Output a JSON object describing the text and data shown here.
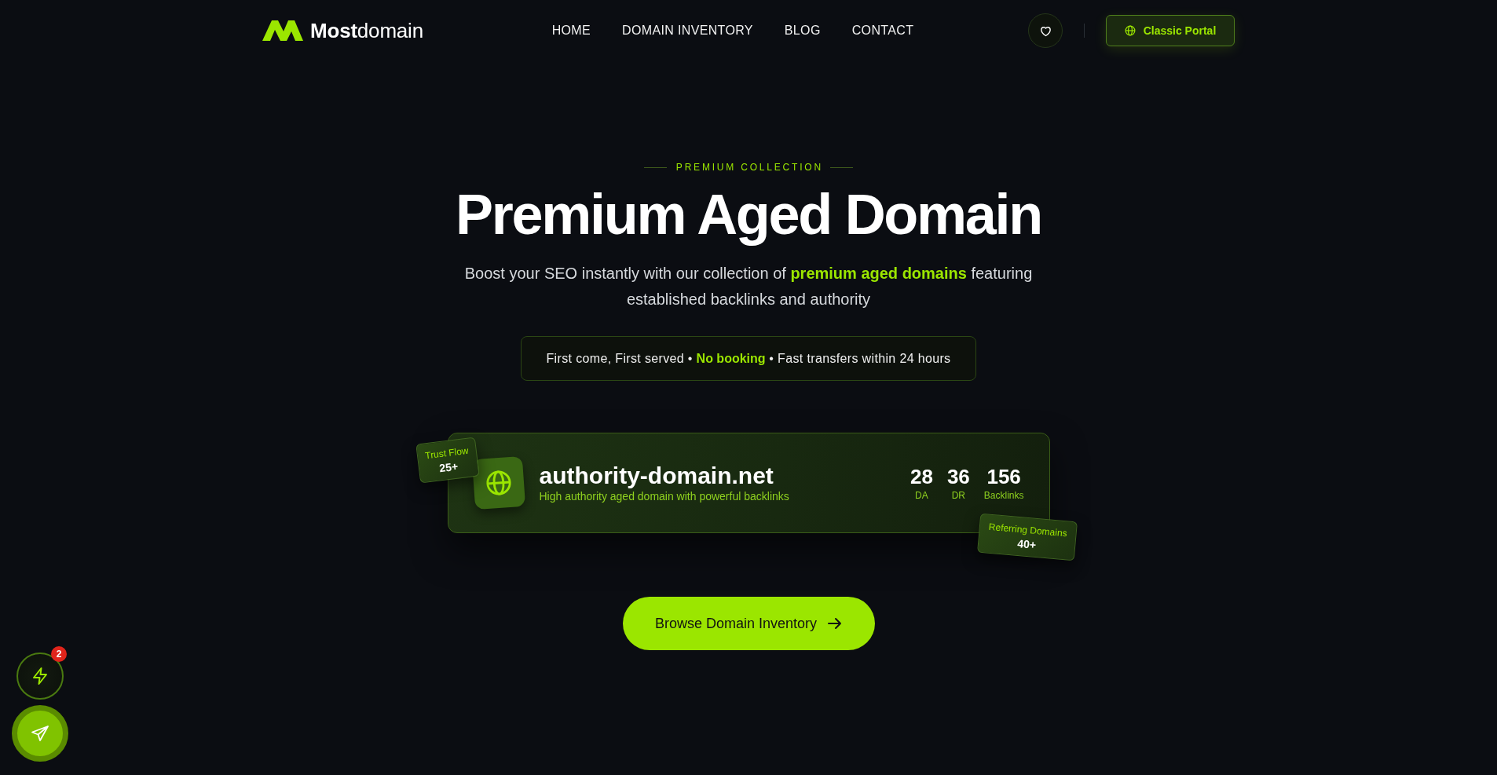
{
  "header": {
    "brand": "**Most**domain",
    "nav": [
      "HOME",
      "DOMAIN INVENTORY",
      "BLOG",
      "CONTACT"
    ],
    "portal_button": "Classic Portal"
  },
  "hero": {
    "eyebrow": "PREMIUM COLLECTION",
    "title": "Premium Aged Domain",
    "subtitle": "Boost your SEO instantly with our collection of **premium aged domains** featuring established backlinks and authority",
    "notice": "First come, First served • **No booking** • Fast transfers within 24 hours"
  },
  "domain_card": {
    "domain": "authority-domain.net",
    "description": "High authority aged domain with powerful backlinks",
    "stats": [
      {
        "value": "28",
        "label": "DA"
      },
      {
        "value": "36",
        "label": "DR"
      },
      {
        "value": "156",
        "label": "Backlinks"
      }
    ],
    "badges": [
      {
        "label": "Trust Flow",
        "value": "25+"
      },
      {
        "label": "Referring Domains",
        "value": "40+"
      }
    ]
  },
  "cta": {
    "label": "Browse Domain Inventory"
  },
  "quick_actions": {
    "notification_count": "2"
  }
}
